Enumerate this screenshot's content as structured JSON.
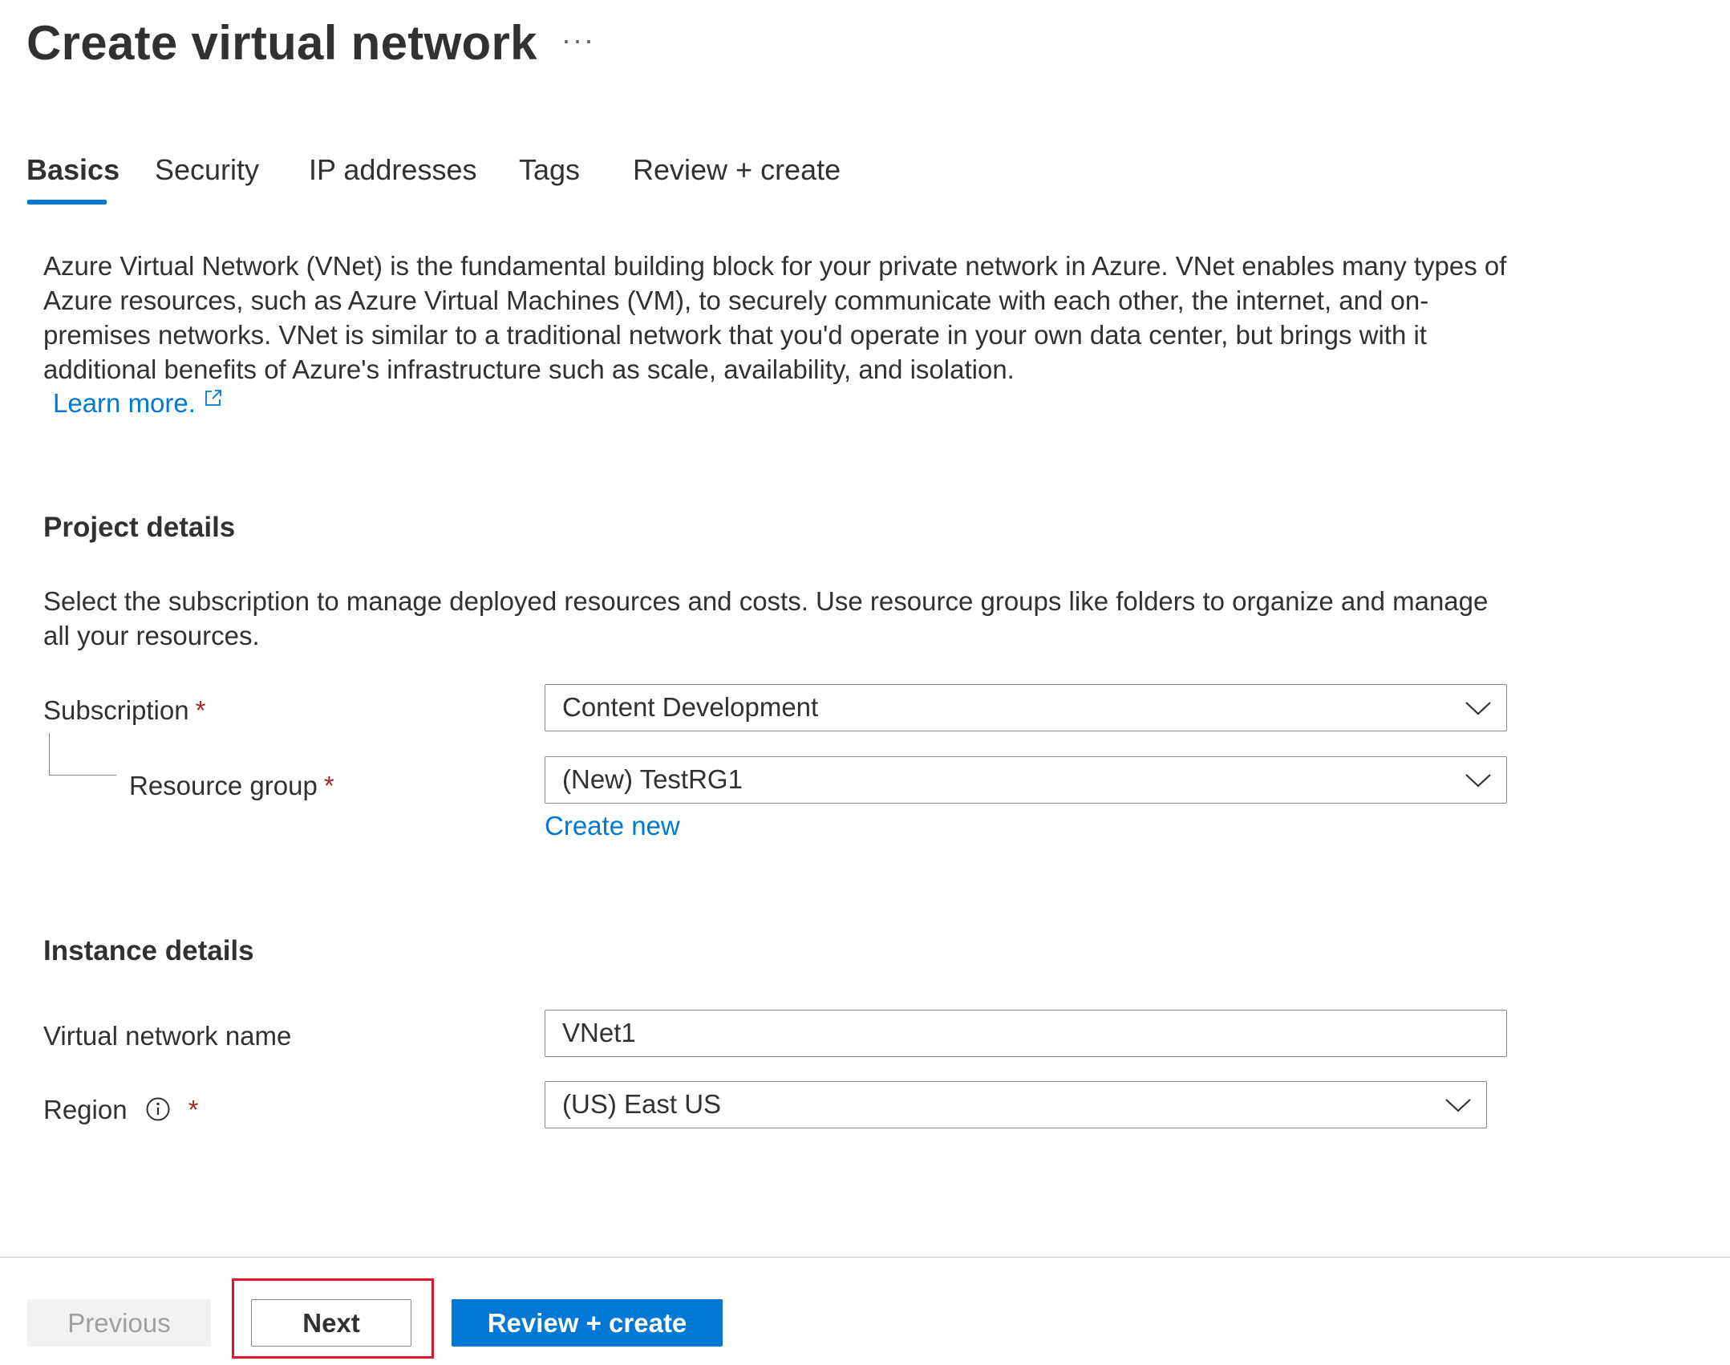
{
  "header": {
    "title": "Create virtual network",
    "more_label": "···"
  },
  "tabs": [
    {
      "label": "Basics",
      "active": true
    },
    {
      "label": "Security",
      "active": false
    },
    {
      "label": "IP addresses",
      "active": false
    },
    {
      "label": "Tags",
      "active": false
    },
    {
      "label": "Review + create",
      "active": false
    }
  ],
  "intro": {
    "description": "Azure Virtual Network (VNet) is the fundamental building block for your private network in Azure. VNet enables many types of Azure resources, such as Azure Virtual Machines (VM), to securely communicate with each other, the internet, and on-premises networks. VNet is similar to a traditional network that you'd operate in your own data center, but brings with it additional benefits of Azure's infrastructure such as scale, availability, and isolation.",
    "learn_more": "Learn more.",
    "learn_more_icon": "external-link-icon"
  },
  "project_details": {
    "heading": "Project details",
    "description": "Select the subscription to manage deployed resources and costs. Use resource groups like folders to organize and manage all your resources.",
    "subscription": {
      "label": "Subscription",
      "required_mark": "*",
      "value": "Content Development"
    },
    "resource_group": {
      "label": "Resource group",
      "required_mark": "*",
      "value": "(New) TestRG1",
      "create_new": "Create new"
    }
  },
  "instance_details": {
    "heading": "Instance details",
    "vnet_name": {
      "label": "Virtual network name",
      "value": "VNet1"
    },
    "region": {
      "label": "Region",
      "required_mark": "*",
      "value": "(US) East US",
      "info_icon": "info-icon"
    }
  },
  "footer": {
    "previous": "Previous",
    "next": "Next",
    "review_create": "Review + create"
  },
  "colors": {
    "accent": "#0078d4",
    "required": "#a4262c",
    "highlight": "#e3142b",
    "text": "#323130",
    "disabled_text": "#a19f9d"
  }
}
